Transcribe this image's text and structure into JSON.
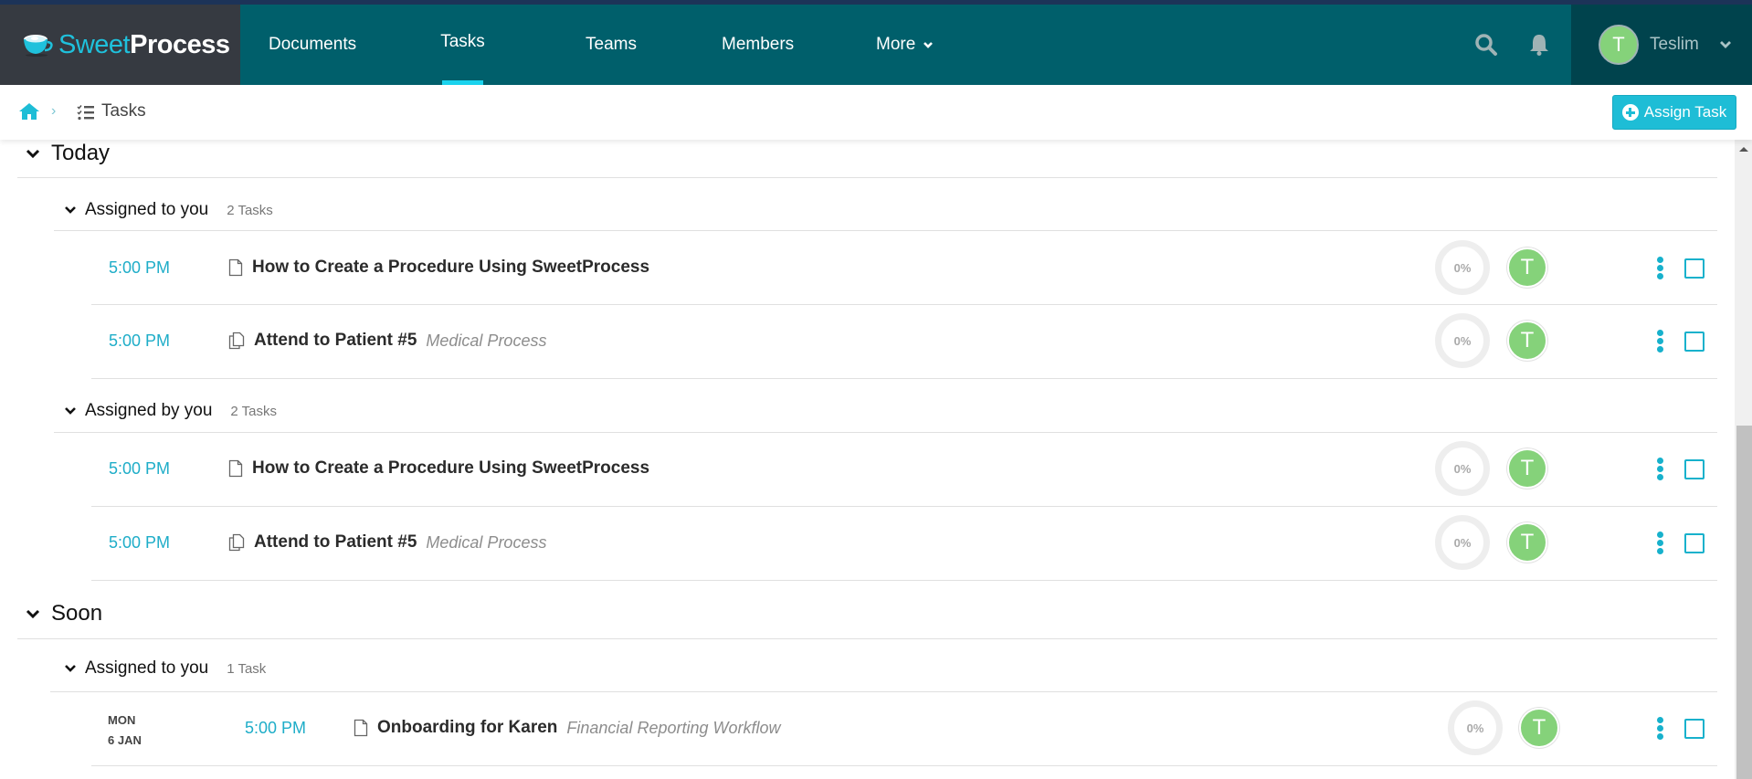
{
  "brand": {
    "part1": "Sweet",
    "part2": "Process"
  },
  "nav": {
    "items": [
      {
        "label": "Documents",
        "active": false
      },
      {
        "label": "Tasks",
        "active": true
      },
      {
        "label": "Teams",
        "active": false
      },
      {
        "label": "Members",
        "active": false
      },
      {
        "label": "More",
        "active": false,
        "has_dropdown": true
      }
    ],
    "icons": [
      "search-icon",
      "bell-icon"
    ],
    "user": {
      "initial": "T",
      "name": "Teslim"
    }
  },
  "breadcrumb": {
    "home_icon": "home-icon",
    "separator": "›",
    "current_icon": "tasks-list-icon",
    "current": "Tasks"
  },
  "actions": {
    "assign_task": "Assign Task"
  },
  "colors": {
    "brand_teal": "#005f6b",
    "accent_cyan": "#1ebdd6",
    "avatar_green": "#85d27a"
  },
  "groups": [
    {
      "label": "Today",
      "subgroups": [
        {
          "label": "Assigned to you",
          "count": "2 Tasks",
          "tasks": [
            {
              "time": "5:00 PM",
              "icon": "document-icon",
              "title": "How to Create a Procedure Using SweetProcess",
              "subtitle": "",
              "progress": "0%",
              "assignee": "T"
            },
            {
              "time": "5:00 PM",
              "icon": "process-icon",
              "title": "Attend to Patient #5",
              "subtitle": "Medical Process",
              "progress": "0%",
              "assignee": "T"
            }
          ]
        },
        {
          "label": "Assigned by you",
          "count": "2 Tasks",
          "tasks": [
            {
              "time": "5:00 PM",
              "icon": "document-icon",
              "title": "How to Create a Procedure Using SweetProcess",
              "subtitle": "",
              "progress": "0%",
              "assignee": "T"
            },
            {
              "time": "5:00 PM",
              "icon": "process-icon",
              "title": "Attend to Patient #5",
              "subtitle": "Medical Process",
              "progress": "0%",
              "assignee": "T"
            }
          ]
        }
      ]
    },
    {
      "label": "Soon",
      "subgroups": [
        {
          "label": "Assigned to you",
          "count": "1 Task",
          "tasks": [
            {
              "day": "MON",
              "date": "6 JAN",
              "time": "5:00 PM",
              "icon": "document-icon",
              "title": "Onboarding for Karen",
              "subtitle": "Financial Reporting Workflow",
              "progress": "0%",
              "assignee": "T"
            }
          ]
        }
      ]
    }
  ]
}
